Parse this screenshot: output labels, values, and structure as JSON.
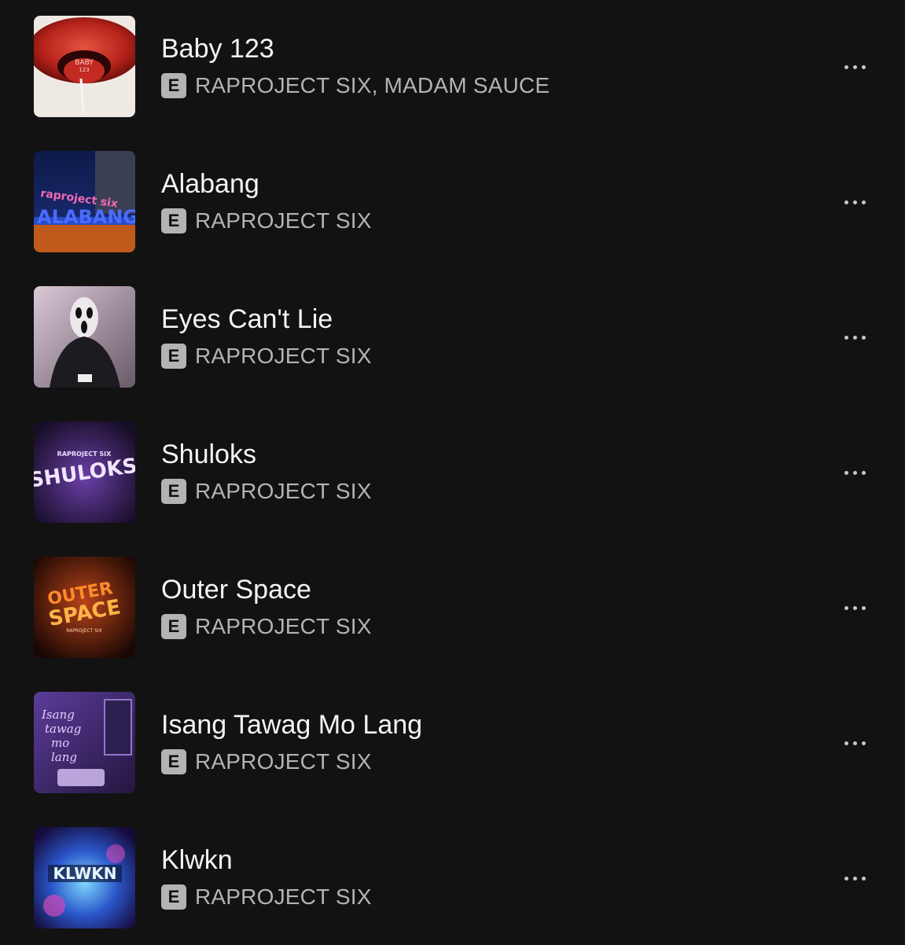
{
  "tracks": [
    {
      "title": "Baby 123",
      "artists": "RAPROJECT SIX, MADAM SAUCE",
      "explicit": "E",
      "cover_icon": "album-art-baby-123",
      "cover_text": "BABY 123"
    },
    {
      "title": "Alabang",
      "artists": "RAPROJECT SIX",
      "explicit": "E",
      "cover_icon": "album-art-alabang",
      "cover_text": "raproject six ALABANG"
    },
    {
      "title": "Eyes Can't Lie",
      "artists": "RAPROJECT SIX",
      "explicit": "E",
      "cover_icon": "album-art-eyes-cant-lie"
    },
    {
      "title": "Shuloks",
      "artists": "RAPROJECT SIX",
      "explicit": "E",
      "cover_icon": "album-art-shuloks",
      "cover_text": "RAPROJECT SIX SHULOKS"
    },
    {
      "title": "Outer Space",
      "artists": "RAPROJECT SIX",
      "explicit": "E",
      "cover_icon": "album-art-outer-space",
      "cover_text": "OUTER SPACE RAPROJECT SIX"
    },
    {
      "title": "Isang Tawag Mo Lang",
      "artists": "RAPROJECT SIX",
      "explicit": "E",
      "cover_icon": "album-art-isang-tawag-mo-lang",
      "cover_text": "Isang tawag mo lang"
    },
    {
      "title": "Klwkn",
      "artists": "RAPROJECT SIX",
      "explicit": "E",
      "cover_icon": "album-art-klwkn",
      "cover_text": "KLWKN"
    }
  ],
  "more_icon": "more-options-icon",
  "colors": {
    "background": "#121212",
    "title": "#f4f4f4",
    "secondary": "#b3b3b3"
  }
}
